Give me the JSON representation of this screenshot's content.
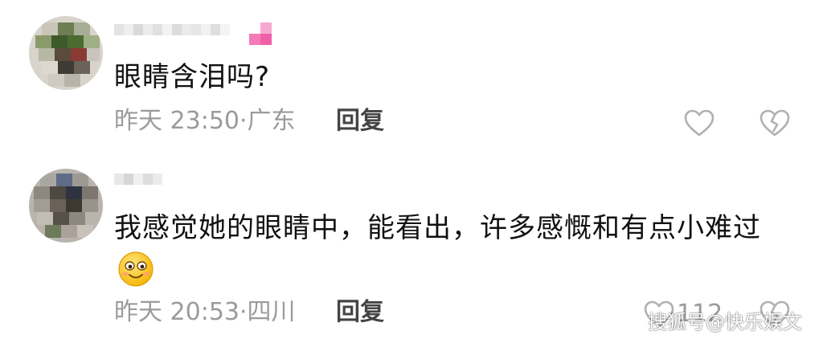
{
  "colors": {
    "text": "#111111",
    "meta": "#9b9b9b",
    "reply": "#444444",
    "icon": "#b0b0b0"
  },
  "comments": [
    {
      "text": "眼睛含泪吗?",
      "time": "昨天 23:50",
      "location": "广东",
      "reply_label": "回复",
      "like_icon": "heart-outline-icon",
      "dislike_icon": "broken-heart-icon"
    },
    {
      "text": "我感觉她的眼睛中，能看出，许多感慨和有点小难过",
      "emoji": "smiling-face-emoji",
      "time": "昨天 20:53",
      "location": "四川",
      "reply_label": "回复",
      "like_count": "112",
      "like_icon": "heart-outline-icon",
      "dislike_icon": "broken-heart-icon"
    }
  ],
  "watermark": "搜狐号@快乐娱文"
}
